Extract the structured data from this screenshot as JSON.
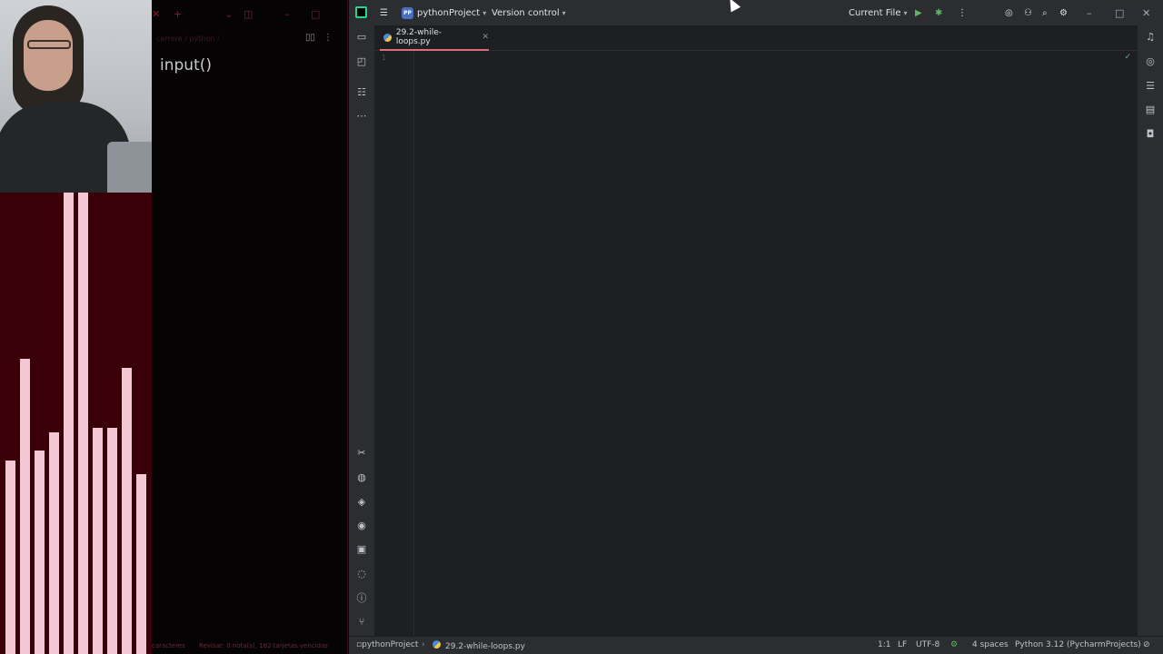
{
  "notes": {
    "crumb": "carrera / python /",
    "title": "input()",
    "footer_left": "caracteres",
    "footer_right": "Revisar: 0 nota(s), 182 tarjetas vencidas"
  },
  "visualizer": {
    "levels": [
      0.42,
      0.64,
      0.44,
      0.48,
      1.0,
      1.0,
      0.49,
      0.49,
      0.62,
      0.39
    ]
  },
  "ide": {
    "project_badge": "PP",
    "project_name": "pythonProject",
    "vcs_label": "Version control",
    "run_config": "Current File",
    "tab_file": "29.2-while-loops.py",
    "line_number": "1",
    "status": {
      "breadcrumb_project": "pythonProject",
      "breadcrumb_file": "29.2-while-loops.py",
      "caret": "1:1",
      "line_sep": "LF",
      "encoding": "UTF-8",
      "indent": "4 spaces",
      "interpreter": "Python 3.12 (PycharmProjects)"
    }
  },
  "icons": {
    "accent": "#e06c75",
    "brand": "#21d789"
  }
}
